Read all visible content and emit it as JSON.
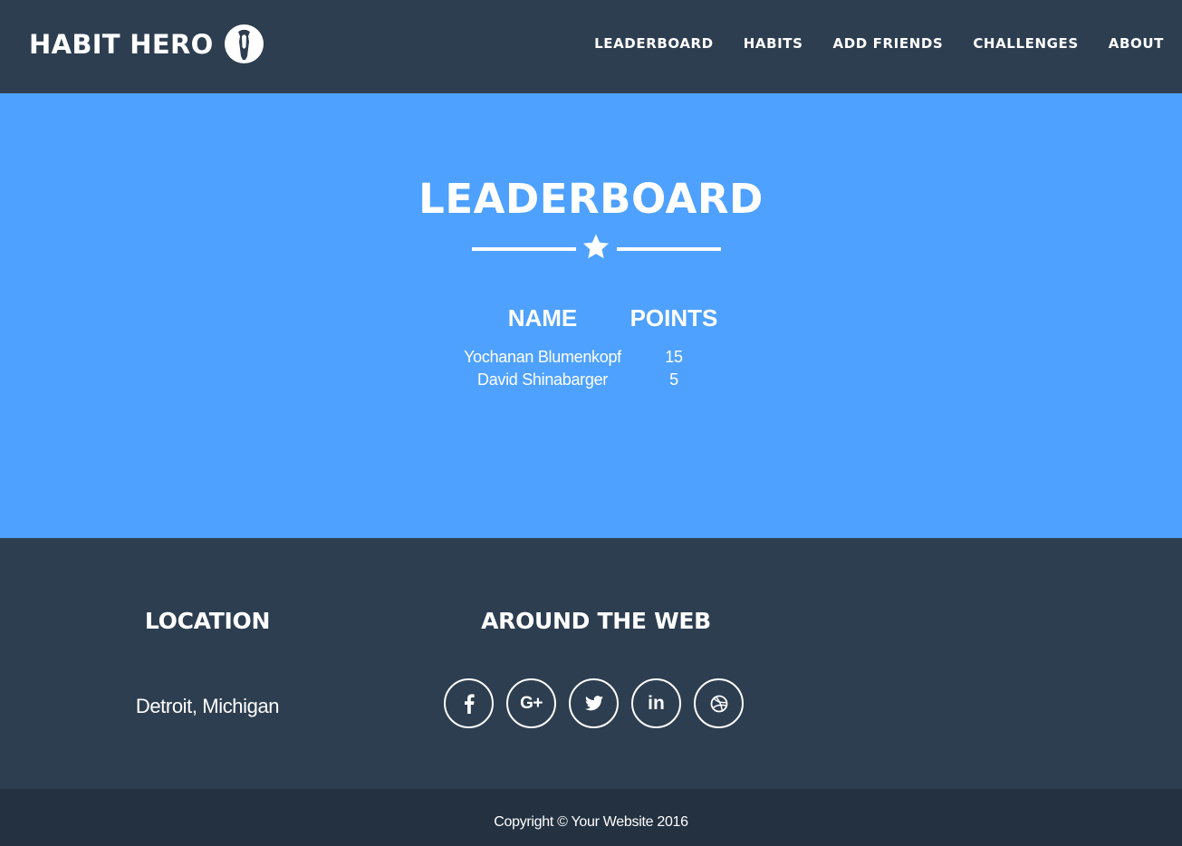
{
  "navbar": {
    "brand": "HABIT HERO",
    "brand_logo_icon": "hero-silhouette-icon",
    "links": [
      {
        "label": "LEADERBOARD"
      },
      {
        "label": "HABITS"
      },
      {
        "label": "ADD FRIENDS"
      },
      {
        "label": "CHALLENGES"
      },
      {
        "label": "ABOUT"
      }
    ]
  },
  "hero": {
    "title": "LEADERBOARD",
    "divider_icon": "star-icon",
    "table": {
      "headers": {
        "name": "NAME",
        "points": "POINTS"
      },
      "rows": [
        {
          "name": "Yochanan Blumenkopf",
          "points": "15"
        },
        {
          "name": "David Shinabarger",
          "points": "5"
        }
      ]
    }
  },
  "footer": {
    "location_heading": "LOCATION",
    "location_text": "Detroit, Michigan",
    "web_heading": "AROUND THE WEB",
    "social": [
      {
        "icon": "facebook-icon",
        "glyph": "f"
      },
      {
        "icon": "google-plus-icon",
        "glyph": "G+"
      },
      {
        "icon": "twitter-icon",
        "glyph": ""
      },
      {
        "icon": "linkedin-icon",
        "glyph": "in"
      },
      {
        "icon": "dribbble-icon",
        "glyph": ""
      }
    ]
  },
  "copyright": "Copyright © Your Website 2016",
  "colors": {
    "navbar_bg": "#2d3e50",
    "hero_bg": "#4ea1ff",
    "footer_bg": "#2d3e50",
    "copyright_bg": "#233140",
    "text": "#ffffff"
  }
}
